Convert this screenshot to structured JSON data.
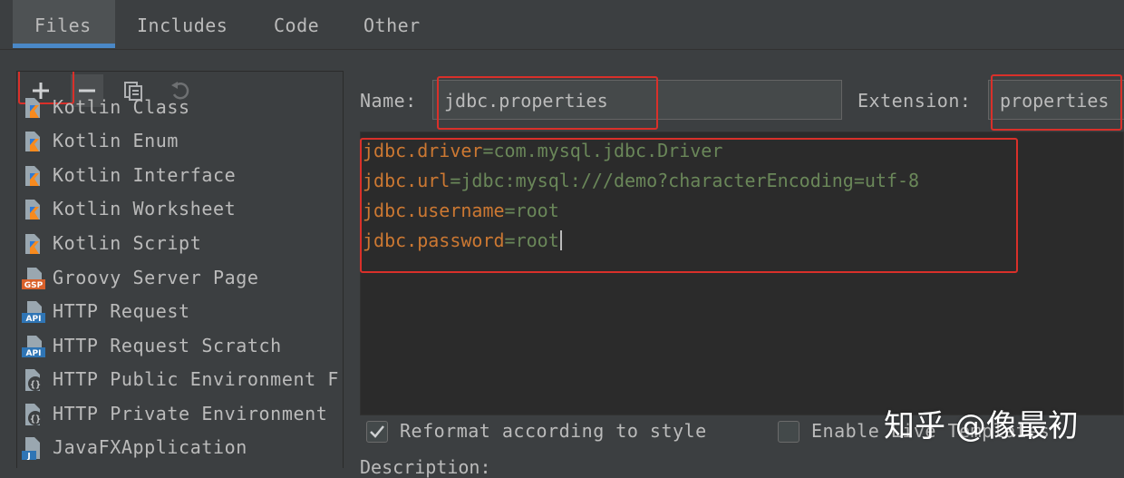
{
  "tabs": [
    {
      "label": "Files",
      "active": true
    },
    {
      "label": "Includes"
    },
    {
      "label": "Code"
    },
    {
      "label": "Other"
    }
  ],
  "toolbar": {
    "add_icon": "plus-icon",
    "remove_icon": "minus-icon",
    "copy_icon": "copy-icon",
    "reset_icon": "undo-icon"
  },
  "templates": [
    {
      "label": "Kotlin Class",
      "icon": "kotlin-file-icon"
    },
    {
      "label": "Kotlin Enum",
      "icon": "kotlin-file-icon"
    },
    {
      "label": "Kotlin Interface",
      "icon": "kotlin-file-icon"
    },
    {
      "label": "Kotlin Worksheet",
      "icon": "kotlin-file-icon"
    },
    {
      "label": "Kotlin Script",
      "icon": "kotlin-file-icon"
    },
    {
      "label": "Groovy Server Page",
      "icon": "gsp-file-icon",
      "badge": "GSP"
    },
    {
      "label": "HTTP Request",
      "icon": "api-file-icon",
      "badge": "API"
    },
    {
      "label": "HTTP Request Scratch",
      "icon": "api-file-icon",
      "badge": "API"
    },
    {
      "label": "HTTP Public Environment F",
      "icon": "json-file-icon",
      "badge": "{}"
    },
    {
      "label": "HTTP Private Environment",
      "icon": "json-file-icon",
      "badge": "{}"
    },
    {
      "label": "JavaFXApplication",
      "icon": "java-file-icon",
      "badge": "J"
    }
  ],
  "form": {
    "name_label": "Name:",
    "name_value": "jdbc.properties",
    "extension_label": "Extension:",
    "extension_value": "properties"
  },
  "editor": {
    "lines": [
      {
        "key": "jdbc.driver",
        "eq": "=",
        "value": "com.mysql.jdbc.Driver"
      },
      {
        "key": "jdbc.url",
        "eq": "=",
        "value": "jdbc:mysql:///demo?characterEncoding=utf-8"
      },
      {
        "key": "jdbc.username",
        "eq": "=",
        "value": "root"
      },
      {
        "key": "jdbc.password",
        "eq": "=",
        "value": "root"
      }
    ]
  },
  "options": {
    "reformat_label": "Reformat according to style",
    "reformat_checked": true,
    "live_templates_label": "Enable Live Templates",
    "live_templates_checked": false
  },
  "description_label": "Description:",
  "watermark": "知乎 @像最初",
  "colors": {
    "background": "#3c3f41",
    "editor_bg": "#2b2b2b",
    "key": "#cc7832",
    "value": "#6a8759",
    "highlight_box": "#d9302a",
    "tab_underline": "#4a88c7"
  }
}
